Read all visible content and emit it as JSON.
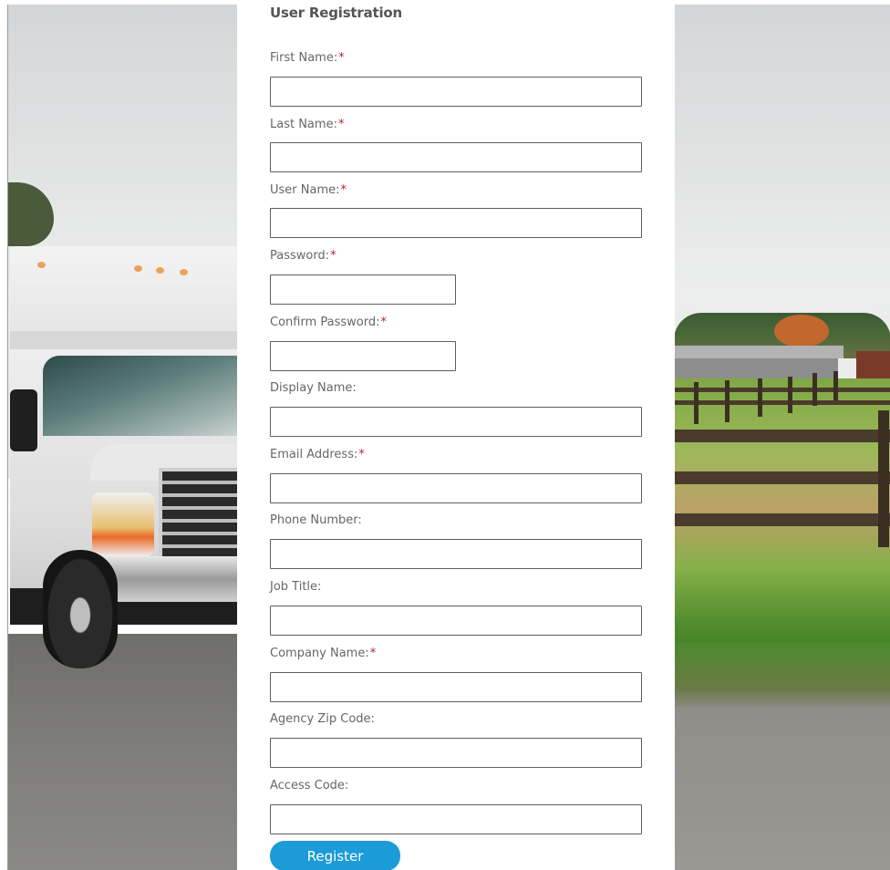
{
  "form": {
    "title": "User Registration",
    "required_marker": "*",
    "fields": [
      {
        "label": "First Name:",
        "required": true,
        "value": ""
      },
      {
        "label": "Last Name:",
        "required": true,
        "value": ""
      },
      {
        "label": "User Name:",
        "required": true,
        "value": ""
      },
      {
        "label": "Password:",
        "required": true,
        "value": ""
      },
      {
        "label": "Confirm Password:",
        "required": true,
        "value": ""
      },
      {
        "label": "Display Name:",
        "required": false,
        "value": ""
      },
      {
        "label": "Email Address:",
        "required": true,
        "value": ""
      },
      {
        "label": "Phone Number:",
        "required": false,
        "value": ""
      },
      {
        "label": "Job Title:",
        "required": false,
        "value": ""
      },
      {
        "label": "Company Name:",
        "required": true,
        "value": ""
      },
      {
        "label": "Agency Zip Code:",
        "required": false,
        "value": ""
      },
      {
        "label": "Access Code:",
        "required": false,
        "value": ""
      }
    ],
    "register_label": "Register"
  },
  "colors": {
    "accent_button": "#1b9bd8",
    "required_marker": "#b0262d",
    "label_text": "#666666",
    "title_text": "#555555"
  }
}
